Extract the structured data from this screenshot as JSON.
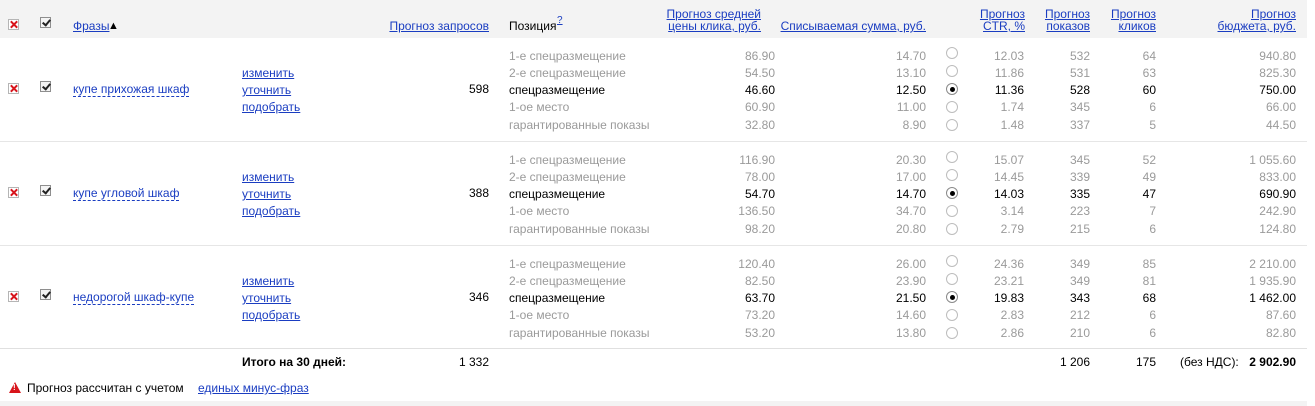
{
  "header": {
    "phrases": "Фразы",
    "sort_arrow": "▲",
    "forecast_requests": "Прогноз запросов",
    "position": "Позиция",
    "position_help": "?",
    "avg_click_line1": "Прогноз средней",
    "avg_click_line2": "цены клика, руб.",
    "charged_sum": "Списываемая сумма, руб.",
    "ctr_line1": "Прогноз",
    "ctr_line2": "CTR, %",
    "shows_line1": "Прогноз",
    "shows_line2": "показов",
    "clicks_line1": "Прогноз",
    "clicks_line2": "кликов",
    "budget_line1": "Прогноз",
    "budget_line2": "бюджета, руб."
  },
  "actions": {
    "edit": "изменить",
    "refine": "уточнить",
    "pick": "подобрать"
  },
  "rows": [
    {
      "phrase": "купе прихожая шкаф",
      "requests": "598",
      "positions": [
        {
          "name": "1-е спецразмещение",
          "price": "86.90",
          "sum": "14.70",
          "ctr": "12.03",
          "shows": "532",
          "clicks": "64",
          "budget": "940.80"
        },
        {
          "name": "2-е спецразмещение",
          "price": "54.50",
          "sum": "13.10",
          "ctr": "11.86",
          "shows": "531",
          "clicks": "63",
          "budget": "825.30"
        },
        {
          "name": "спецразмещение",
          "price": "46.60",
          "sum": "12.50",
          "ctr": "11.36",
          "shows": "528",
          "clicks": "60",
          "budget": "750.00"
        },
        {
          "name": "1-ое место",
          "price": "60.90",
          "sum": "11.00",
          "ctr": "1.74",
          "shows": "345",
          "clicks": "6",
          "budget": "66.00"
        },
        {
          "name": "гарантированные показы",
          "price": "32.80",
          "sum": "8.90",
          "ctr": "1.48",
          "shows": "337",
          "clicks": "5",
          "budget": "44.50"
        }
      ]
    },
    {
      "phrase": "купе угловой шкаф",
      "requests": "388",
      "positions": [
        {
          "name": "1-е спецразмещение",
          "price": "116.90",
          "sum": "20.30",
          "ctr": "15.07",
          "shows": "345",
          "clicks": "52",
          "budget": "1 055.60"
        },
        {
          "name": "2-е спецразмещение",
          "price": "78.00",
          "sum": "17.00",
          "ctr": "14.45",
          "shows": "339",
          "clicks": "49",
          "budget": "833.00"
        },
        {
          "name": "спецразмещение",
          "price": "54.70",
          "sum": "14.70",
          "ctr": "14.03",
          "shows": "335",
          "clicks": "47",
          "budget": "690.90"
        },
        {
          "name": "1-ое место",
          "price": "136.50",
          "sum": "34.70",
          "ctr": "3.14",
          "shows": "223",
          "clicks": "7",
          "budget": "242.90"
        },
        {
          "name": "гарантированные показы",
          "price": "98.20",
          "sum": "20.80",
          "ctr": "2.79",
          "shows": "215",
          "clicks": "6",
          "budget": "124.80"
        }
      ]
    },
    {
      "phrase": "недорогой шкаф-купе",
      "requests": "346",
      "positions": [
        {
          "name": "1-е спецразмещение",
          "price": "120.40",
          "sum": "26.00",
          "ctr": "24.36",
          "shows": "349",
          "clicks": "85",
          "budget": "2 210.00"
        },
        {
          "name": "2-е спецразмещение",
          "price": "82.50",
          "sum": "23.90",
          "ctr": "23.21",
          "shows": "349",
          "clicks": "81",
          "budget": "1 935.90"
        },
        {
          "name": "спецразмещение",
          "price": "63.70",
          "sum": "21.50",
          "ctr": "19.83",
          "shows": "343",
          "clicks": "68",
          "budget": "1 462.00"
        },
        {
          "name": "1-ое место",
          "price": "73.20",
          "sum": "14.60",
          "ctr": "2.83",
          "shows": "212",
          "clicks": "6",
          "budget": "87.60"
        },
        {
          "name": "гарантированные показы",
          "price": "53.20",
          "sum": "13.80",
          "ctr": "2.86",
          "shows": "210",
          "clicks": "6",
          "budget": "82.80"
        }
      ]
    }
  ],
  "selected_position_index": 2,
  "totals": {
    "label": "Итого на 30 дней:",
    "requests": "1 332",
    "shows": "1 206",
    "clicks": "175",
    "vat_label": "(без НДС):",
    "budget": "2 902.90"
  },
  "note": {
    "text": "Прогноз рассчитан с учетом",
    "link": "единых минус-фраз"
  },
  "colors": {
    "link": "#1a3dc1",
    "header_bg": "#f3f3f3",
    "muted": "#9a9a9a",
    "delete_red": "#d8141b"
  }
}
